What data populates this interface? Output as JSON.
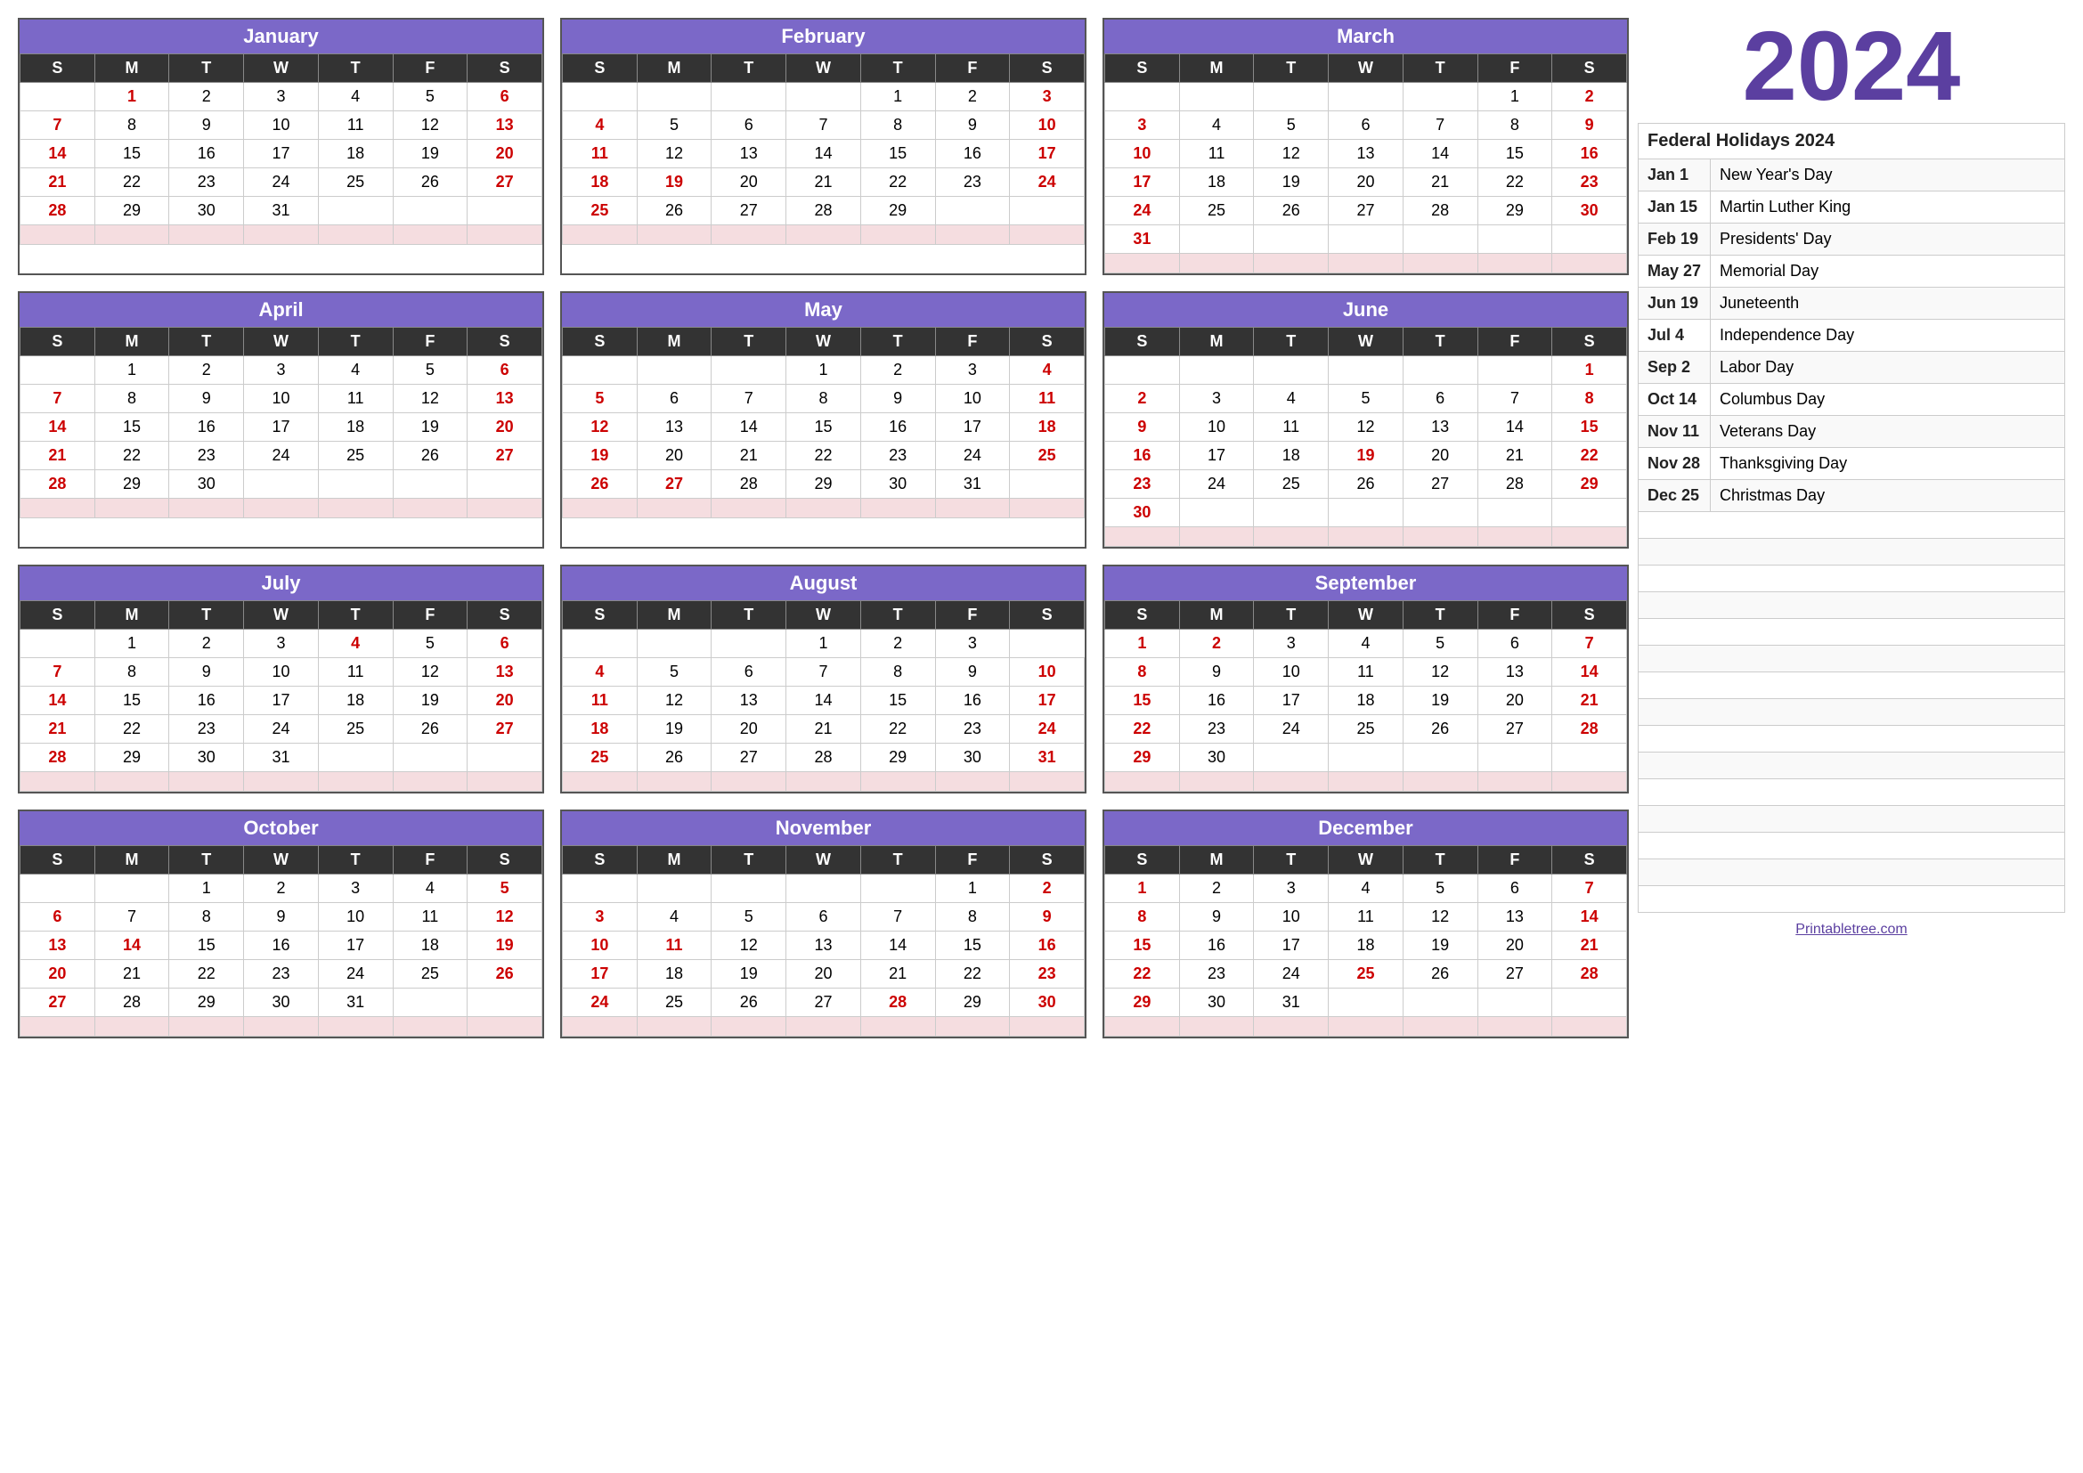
{
  "year": "2024",
  "colors": {
    "purple": "#7b68c8",
    "darkText": "#222",
    "red": "#cc0000",
    "yearColor": "#5b3fa0"
  },
  "holidays": {
    "header": "Federal Holidays 2024",
    "items": [
      {
        "date": "Jan 1",
        "name": "New Year's Day"
      },
      {
        "date": "Jan 15",
        "name": "Martin Luther King"
      },
      {
        "date": "Feb 19",
        "name": "Presidents' Day"
      },
      {
        "date": "May 27",
        "name": "Memorial Day"
      },
      {
        "date": "Jun 19",
        "name": "Juneteenth"
      },
      {
        "date": "Jul 4",
        "name": "Independence Day"
      },
      {
        "date": "Sep 2",
        "name": "Labor Day"
      },
      {
        "date": "Oct 14",
        "name": "Columbus Day"
      },
      {
        "date": "Nov 11",
        "name": "Veterans Day"
      },
      {
        "date": "Nov 28",
        "name": "Thanksgiving Day"
      },
      {
        "date": "Dec 25",
        "name": "Christmas Day"
      }
    ]
  },
  "printUrl": "Printabletree.com",
  "months": [
    {
      "name": "January",
      "days": [
        [
          "",
          "1",
          "2",
          "3",
          "4",
          "5",
          "6"
        ],
        [
          "7",
          "8",
          "9",
          "10",
          "11",
          "12",
          "13"
        ],
        [
          "14",
          "15",
          "16",
          "17",
          "18",
          "19",
          "20"
        ],
        [
          "21",
          "22",
          "23",
          "24",
          "25",
          "26",
          "27"
        ],
        [
          "28",
          "29",
          "30",
          "31",
          "",
          "",
          ""
        ]
      ],
      "holidays": [
        "1"
      ],
      "sundays": [
        "7",
        "14",
        "21",
        "28"
      ],
      "saturdays": [
        "6",
        "13",
        "20",
        "27"
      ]
    },
    {
      "name": "February",
      "days": [
        [
          "",
          "",
          "",
          "",
          "1",
          "2",
          "3"
        ],
        [
          "4",
          "5",
          "6",
          "7",
          "8",
          "9",
          "10"
        ],
        [
          "11",
          "12",
          "13",
          "14",
          "15",
          "16",
          "17"
        ],
        [
          "18",
          "19",
          "20",
          "21",
          "22",
          "23",
          "24"
        ],
        [
          "25",
          "26",
          "27",
          "28",
          "29",
          "",
          ""
        ]
      ],
      "holidays": [
        "19"
      ],
      "sundays": [
        "4",
        "11",
        "18",
        "25"
      ],
      "saturdays": [
        "3",
        "10",
        "17",
        "24"
      ]
    },
    {
      "name": "March",
      "days": [
        [
          "",
          "",
          "",
          "",
          "",
          "1",
          "2"
        ],
        [
          "3",
          "4",
          "5",
          "6",
          "7",
          "8",
          "9"
        ],
        [
          "10",
          "11",
          "12",
          "13",
          "14",
          "15",
          "16"
        ],
        [
          "17",
          "18",
          "19",
          "20",
          "21",
          "22",
          "23"
        ],
        [
          "24",
          "25",
          "26",
          "27",
          "28",
          "29",
          "30"
        ],
        [
          "31",
          "",
          "",
          "",
          "",
          "",
          ""
        ]
      ],
      "holidays": [],
      "sundays": [
        "3",
        "10",
        "17",
        "24",
        "31"
      ],
      "saturdays": [
        "2",
        "9",
        "16",
        "23",
        "30"
      ]
    },
    {
      "name": "April",
      "days": [
        [
          "",
          "1",
          "2",
          "3",
          "4",
          "5",
          "6"
        ],
        [
          "7",
          "8",
          "9",
          "10",
          "11",
          "12",
          "13"
        ],
        [
          "14",
          "15",
          "16",
          "17",
          "18",
          "19",
          "20"
        ],
        [
          "21",
          "22",
          "23",
          "24",
          "25",
          "26",
          "27"
        ],
        [
          "28",
          "29",
          "30",
          "",
          "",
          "",
          ""
        ]
      ],
      "holidays": [],
      "sundays": [
        "7",
        "14",
        "21",
        "28"
      ],
      "saturdays": [
        "6",
        "13",
        "20",
        "27"
      ]
    },
    {
      "name": "May",
      "days": [
        [
          "",
          "",
          "",
          "1",
          "2",
          "3",
          "4"
        ],
        [
          "5",
          "6",
          "7",
          "8",
          "9",
          "10",
          "11"
        ],
        [
          "12",
          "13",
          "14",
          "15",
          "16",
          "17",
          "18"
        ],
        [
          "19",
          "20",
          "21",
          "22",
          "23",
          "24",
          "25"
        ],
        [
          "26",
          "27",
          "28",
          "29",
          "30",
          "31",
          ""
        ]
      ],
      "holidays": [
        "27"
      ],
      "sundays": [
        "5",
        "12",
        "19",
        "26"
      ],
      "saturdays": [
        "4",
        "11",
        "18",
        "25"
      ]
    },
    {
      "name": "June",
      "days": [
        [
          "",
          "",
          "",
          "",
          "",
          "",
          "1"
        ],
        [
          "2",
          "3",
          "4",
          "5",
          "6",
          "7",
          "8"
        ],
        [
          "9",
          "10",
          "11",
          "12",
          "13",
          "14",
          "15"
        ],
        [
          "16",
          "17",
          "18",
          "19",
          "20",
          "21",
          "22"
        ],
        [
          "23",
          "24",
          "25",
          "26",
          "27",
          "28",
          "29"
        ],
        [
          "30",
          "",
          "",
          "",
          "",
          "",
          ""
        ]
      ],
      "holidays": [
        "19"
      ],
      "sundays": [
        "2",
        "9",
        "16",
        "23",
        "30"
      ],
      "saturdays": [
        "1",
        "8",
        "15",
        "22",
        "29"
      ]
    },
    {
      "name": "July",
      "days": [
        [
          "",
          "1",
          "2",
          "3",
          "4",
          "5",
          "6"
        ],
        [
          "7",
          "8",
          "9",
          "10",
          "11",
          "12",
          "13"
        ],
        [
          "14",
          "15",
          "16",
          "17",
          "18",
          "19",
          "20"
        ],
        [
          "21",
          "22",
          "23",
          "24",
          "25",
          "26",
          "27"
        ],
        [
          "28",
          "29",
          "30",
          "31",
          "",
          "",
          ""
        ]
      ],
      "holidays": [
        "4"
      ],
      "sundays": [
        "7",
        "14",
        "21",
        "28"
      ],
      "saturdays": [
        "6",
        "13",
        "20",
        "27"
      ]
    },
    {
      "name": "August",
      "days": [
        [
          "",
          "",
          "",
          "1",
          "2",
          "3"
        ],
        [
          "4",
          "5",
          "6",
          "7",
          "8",
          "9",
          "10"
        ],
        [
          "11",
          "12",
          "13",
          "14",
          "15",
          "16",
          "17"
        ],
        [
          "18",
          "19",
          "20",
          "21",
          "22",
          "23",
          "24"
        ],
        [
          "25",
          "26",
          "27",
          "28",
          "29",
          "30",
          "31"
        ]
      ],
      "holidays": [],
      "sundays": [
        "4",
        "11",
        "18",
        "25"
      ],
      "saturdays": [
        "3",
        "10",
        "17",
        "24",
        "31"
      ]
    },
    {
      "name": "September",
      "days": [
        [
          "1",
          "2",
          "3",
          "4",
          "5",
          "6",
          "7"
        ],
        [
          "8",
          "9",
          "10",
          "11",
          "12",
          "13",
          "14"
        ],
        [
          "15",
          "16",
          "17",
          "18",
          "19",
          "20",
          "21"
        ],
        [
          "22",
          "23",
          "24",
          "25",
          "26",
          "27",
          "28"
        ],
        [
          "29",
          "30",
          "",
          "",
          "",
          "",
          ""
        ]
      ],
      "holidays": [
        "2"
      ],
      "sundays": [
        "1",
        "8",
        "15",
        "22",
        "29"
      ],
      "saturdays": [
        "7",
        "14",
        "21",
        "28"
      ]
    },
    {
      "name": "October",
      "days": [
        [
          "",
          "",
          "1",
          "2",
          "3",
          "4",
          "5"
        ],
        [
          "6",
          "7",
          "8",
          "9",
          "10",
          "11",
          "12"
        ],
        [
          "13",
          "14",
          "15",
          "16",
          "17",
          "18",
          "19"
        ],
        [
          "20",
          "21",
          "22",
          "23",
          "24",
          "25",
          "26"
        ],
        [
          "27",
          "28",
          "29",
          "30",
          "31",
          "",
          ""
        ]
      ],
      "holidays": [
        "14"
      ],
      "sundays": [
        "6",
        "13",
        "20",
        "27"
      ],
      "saturdays": [
        "5",
        "12",
        "19",
        "26"
      ]
    },
    {
      "name": "November",
      "days": [
        [
          "",
          "",
          "",
          "",
          "",
          "1",
          "2"
        ],
        [
          "3",
          "4",
          "5",
          "6",
          "7",
          "8",
          "9"
        ],
        [
          "10",
          "11",
          "12",
          "13",
          "14",
          "15",
          "16"
        ],
        [
          "17",
          "18",
          "19",
          "20",
          "21",
          "22",
          "23"
        ],
        [
          "24",
          "25",
          "26",
          "27",
          "28",
          "29",
          "30"
        ]
      ],
      "holidays": [
        "11",
        "28"
      ],
      "sundays": [
        "3",
        "10",
        "17",
        "24"
      ],
      "saturdays": [
        "2",
        "9",
        "16",
        "23",
        "30"
      ]
    },
    {
      "name": "December",
      "days": [
        [
          "1",
          "2",
          "3",
          "4",
          "5",
          "6",
          "7"
        ],
        [
          "8",
          "9",
          "10",
          "11",
          "12",
          "13",
          "14"
        ],
        [
          "15",
          "16",
          "17",
          "18",
          "19",
          "20",
          "21"
        ],
        [
          "22",
          "23",
          "24",
          "25",
          "26",
          "27",
          "28"
        ],
        [
          "29",
          "30",
          "31",
          "",
          "",
          "",
          ""
        ]
      ],
      "holidays": [
        "25"
      ],
      "sundays": [
        "1",
        "8",
        "15",
        "22",
        "29"
      ],
      "saturdays": [
        "7",
        "14",
        "21",
        "28"
      ]
    }
  ]
}
